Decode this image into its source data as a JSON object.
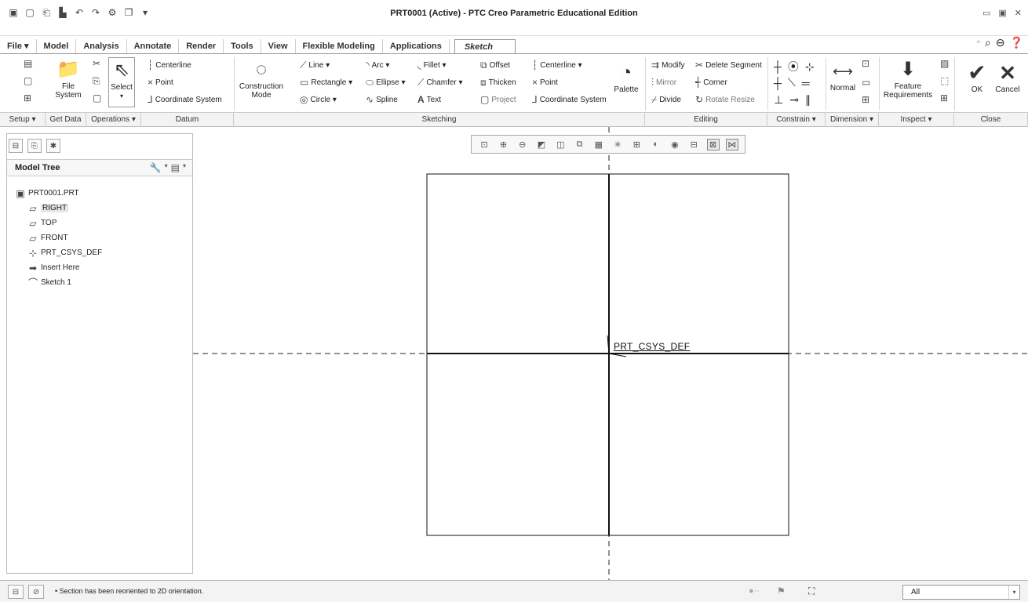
{
  "window": {
    "title": "PRT0001 (Active) - PTC Creo Parametric Educational Edition"
  },
  "tabs": [
    "File ▾",
    "Model",
    "Analysis",
    "Annotate",
    "Render",
    "Tools",
    "View",
    "Flexible Modeling",
    "Applications",
    "Sketch"
  ],
  "ribbon": {
    "file_system": "File\nSystem",
    "select": "Select",
    "datum": {
      "centerline": "Centerline",
      "point": "Point",
      "coordinate_system": "Coordinate System"
    },
    "construction_mode": "Construction\nMode",
    "sketching": {
      "line": "Line ▾",
      "arc": "Arc ▾",
      "fillet": "Fillet ▾",
      "offset": "Offset",
      "centerline": "Centerline ▾",
      "rectangle": "Rectangle ▾",
      "ellipse": "Ellipse ▾",
      "chamfer": "Chamfer ▾",
      "thicken": "Thicken",
      "point": "Point",
      "circle": "Circle ▾",
      "spline": "Spline",
      "text": "Text",
      "project": "Project",
      "coordinate_system": "Coordinate System",
      "palette": "Palette"
    },
    "editing": {
      "modify": "Modify",
      "delete_segment": "Delete Segment",
      "mirror": "Mirror",
      "corner": "Corner",
      "divide": "Divide",
      "rotate_resize": "Rotate Resize"
    },
    "dimension": {
      "normal": "Normal"
    },
    "inspect": {
      "feature_requirements": "Feature\nRequirements"
    },
    "close": {
      "ok": "OK",
      "cancel": "Cancel"
    }
  },
  "groups": [
    "Setup ▾",
    "Get Data",
    "Operations ▾",
    "Datum",
    "Sketching",
    "Editing",
    "Constrain ▾",
    "Dimension ▾",
    "Inspect ▾",
    "Close"
  ],
  "model_tree": {
    "title": "Model Tree",
    "items": [
      "PRT0001.PRT",
      "RIGHT",
      "TOP",
      "FRONT",
      "PRT_CSYS_DEF",
      "Insert Here",
      "Sketch 1"
    ]
  },
  "graphics": {
    "csys_label": "PRT_CSYS_DEF"
  },
  "status": {
    "message": "• Section has been reoriented to 2D orientation.",
    "filter": "All"
  }
}
